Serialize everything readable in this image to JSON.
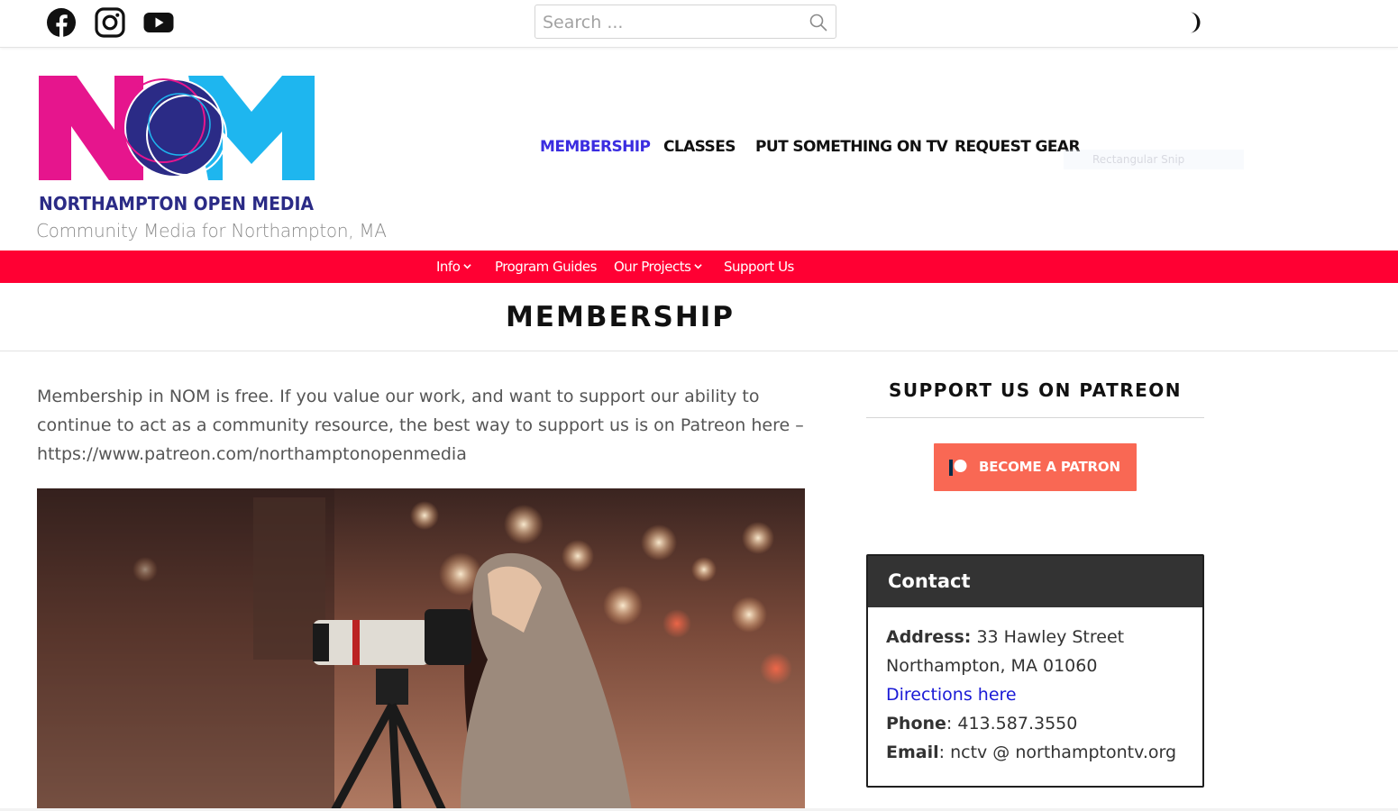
{
  "topbar": {
    "social": [
      {
        "name": "facebook-icon"
      },
      {
        "name": "instagram-icon"
      },
      {
        "name": "youtube-icon"
      }
    ],
    "search": {
      "placeholder": "Search ...",
      "value": ""
    },
    "theme_toggle_icon": "half-moon-icon"
  },
  "header": {
    "logo_text": "NORTHAMPTON OPEN MEDIA",
    "logo_letters": "NOM",
    "tagline": "Community Media for Northampton, MA",
    "nav": [
      {
        "label": "MEMBERSHIP",
        "active": true
      },
      {
        "label": "CLASSES",
        "active": false
      },
      {
        "label": "PUT SOMETHING ON TV",
        "active": false
      },
      {
        "label": "REQUEST GEAR",
        "active": false
      }
    ],
    "overlay_text": "Rectangular Snip"
  },
  "secondary_nav": [
    {
      "label": "Info",
      "has_dropdown": true
    },
    {
      "label": "Program Guides",
      "has_dropdown": false
    },
    {
      "label": "Our Projects",
      "has_dropdown": true
    },
    {
      "label": "Support Us",
      "has_dropdown": false
    }
  ],
  "page": {
    "title": "MEMBERSHIP",
    "intro": "Membership in NOM is free. If you value our work, and want to support our ability to continue to act as a community resource, the best way to support us is on Patreon here – https://www.patreon.com/northamptonopenmedia"
  },
  "sidebar": {
    "patreon_heading": "SUPPORT US ON PATREON",
    "patreon_button": "BECOME A PATRON",
    "contact": {
      "title": "Contact",
      "address_label": "Address:",
      "address_line1": "33 Hawley Street",
      "address_line2": "Northampton, MA 01060",
      "directions_link": "Directions here",
      "phone_label": "Phone",
      "phone": "413.587.3550",
      "email_label": "Email",
      "email": "nctv @ northamptontv.org"
    }
  },
  "colors": {
    "accent_red": "#ff0033",
    "active_nav": "#3b2de0",
    "patreon": "#f96854",
    "logo_magenta": "#e6158d",
    "logo_blue": "#1eb6ef",
    "logo_navy": "#2b2b86"
  }
}
